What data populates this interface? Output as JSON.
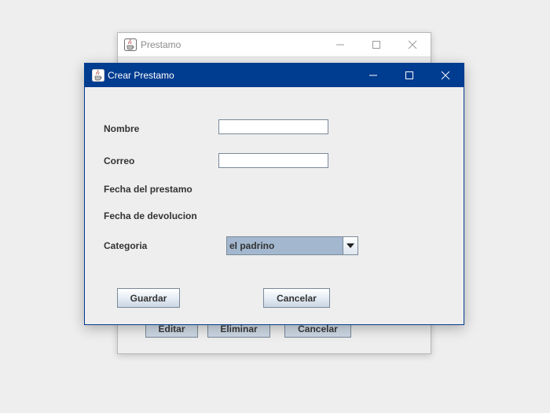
{
  "back_window": {
    "title": "Prestamo",
    "buttons": {
      "edit": "Editar",
      "delete": "Eliminar",
      "cancel": "Cancelar"
    }
  },
  "dialog": {
    "title": "Crear Prestamo",
    "fields": {
      "name_label": "Nombre",
      "name_value": "",
      "email_label": "Correo",
      "email_value": "",
      "loan_date_label": "Fecha del prestamo",
      "return_date_label": "Fecha de devolucion",
      "category_label": "Categoria",
      "category_selected": "el padrino"
    },
    "buttons": {
      "save": "Guardar",
      "cancel": "Cancelar"
    }
  },
  "icons": {
    "app": "java-cup-icon",
    "minimize": "minimize-icon",
    "maximize": "maximize-icon",
    "close": "close-icon",
    "dropdown": "triangle-down-icon"
  },
  "colors": {
    "active_titlebar": "#003c90",
    "combo_selected_bg": "#a3b8cf",
    "desktop_bg": "#eeeeee"
  }
}
